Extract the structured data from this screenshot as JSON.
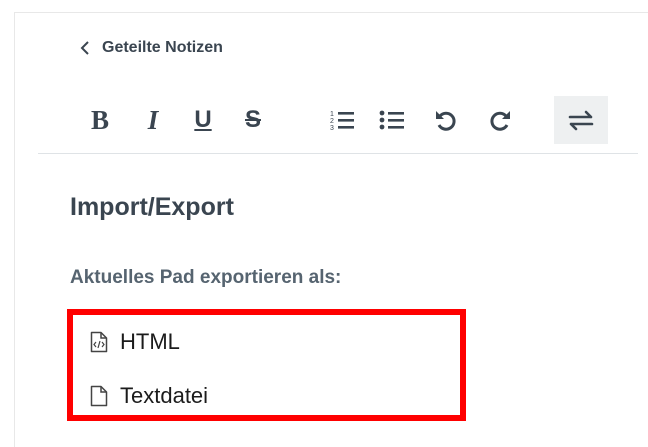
{
  "header": {
    "back_label": "Geteilte Notizen",
    "back_icon": "chevron-left-icon"
  },
  "toolbar": {
    "bold": "B",
    "italic": "I",
    "underline": "U",
    "strikethrough": "S",
    "ordered_list_icon": "ordered-list-icon",
    "unordered_list_icon": "unordered-list-icon",
    "undo_icon": "undo-icon",
    "redo_icon": "redo-icon",
    "import_export_icon": "import-export-icon"
  },
  "main": {
    "title": "Import/Export",
    "export_label": "Aktuelles Pad exportieren als:",
    "export_options": [
      {
        "label": "HTML",
        "icon": "html-file-icon"
      },
      {
        "label": "Textdatei",
        "icon": "text-file-icon"
      }
    ]
  },
  "colors": {
    "text_dark": "#3a4550",
    "text_sub": "#566470",
    "highlight": "#ff0000",
    "active_bg": "#eef0f1"
  }
}
